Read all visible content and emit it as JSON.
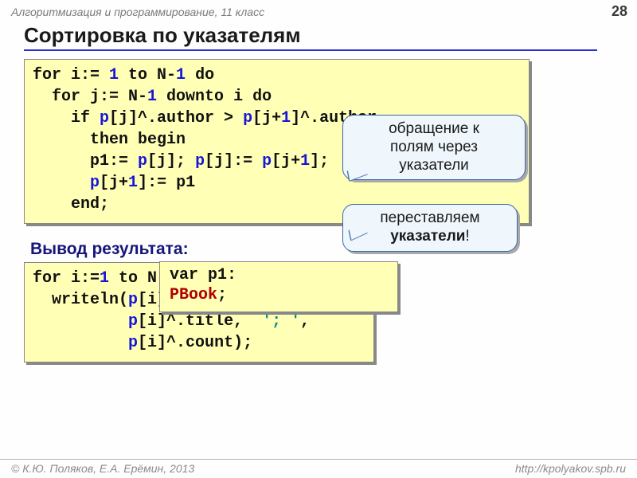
{
  "header": {
    "course": "Алгоритмизация и программирование, 11 класс",
    "page_number": "28"
  },
  "title": "Сортировка по указателям",
  "callouts": {
    "c1_line1": "обращение к",
    "c1_line2": "полям через",
    "c1_line3": "указатели",
    "c2_prefix": "переставляем ",
    "c2_bold": "указатели",
    "c2_suffix": "!"
  },
  "code1": {
    "l1a": "for i:= ",
    "l1b": "1",
    "l1c": " to N-",
    "l1d": "1",
    "l1e": " do",
    "l2a": "  for j:= N-",
    "l2b": "1",
    "l2c": " downto i do",
    "l3a": "    if ",
    "l3b": "p",
    "l3c": "[j]^.author > ",
    "l3d": "p",
    "l3e": "[j+",
    "l3f": "1",
    "l3g": "]^.author",
    "l4": "      then begin",
    "l5a": "      p1:= ",
    "l5b": "p",
    "l5c": "[j]; ",
    "l5d": "p",
    "l5e": "[j]:= ",
    "l5f": "p",
    "l5g": "[j+",
    "l5h": "1",
    "l5i": "];",
    "l6a": "      ",
    "l6b": "p",
    "l6c": "[j+",
    "l6d": "1",
    "l6e": "]:= p1",
    "l7": "    end;"
  },
  "var_decl": {
    "line1a": "var       p1: ",
    "line2": "PBook",
    "line2b": ";"
  },
  "output_heading": "Вывод результата:",
  "code2": {
    "l1a": "for i:=",
    "l1b": "1",
    "l1c": " to N do",
    "l2a": "  writeln(",
    "l2b": "p",
    "l2c": "[i]^.author, ",
    "l2d": "'; '",
    "l2e": ",",
    "l3a": "          ",
    "l3b": "p",
    "l3c": "[i]^.title,  ",
    "l3d": "'; '",
    "l3e": ",",
    "l4a": "          ",
    "l4b": "p",
    "l4c": "[i]^.count);"
  },
  "footer": {
    "copyright": "© К.Ю. Поляков, Е.А. Ерёмин, 2013",
    "url": "http://kpolyakov.spb.ru"
  }
}
